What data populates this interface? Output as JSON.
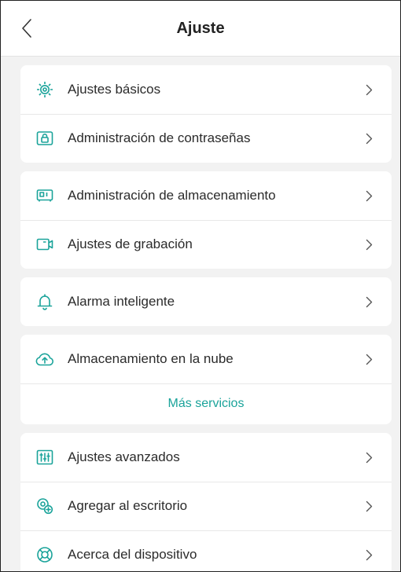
{
  "header": {
    "title": "Ajuste",
    "back_icon": "chevron-left-icon"
  },
  "colors": {
    "accent": "#1aa39a",
    "background": "#f2f2f2",
    "card": "#ffffff",
    "text": "#2b2b2b"
  },
  "groups": [
    {
      "items": [
        {
          "label": "Ajustes básicos",
          "icon": "gear-icon"
        },
        {
          "label": "Administración de contraseñas",
          "icon": "lock-icon"
        }
      ]
    },
    {
      "items": [
        {
          "label": "Administración de almacenamiento",
          "icon": "storage-icon"
        },
        {
          "label": "Ajustes de grabación",
          "icon": "video-camera-icon"
        }
      ]
    },
    {
      "items": [
        {
          "label": "Alarma inteligente",
          "icon": "bell-icon"
        }
      ]
    },
    {
      "items": [
        {
          "label": "Almacenamiento en la nube",
          "icon": "cloud-upload-icon"
        }
      ],
      "more_services": "Más servicios"
    },
    {
      "items": [
        {
          "label": "Ajustes avanzados",
          "icon": "sliders-icon"
        },
        {
          "label": "Agregar al escritorio",
          "icon": "add-desktop-icon"
        },
        {
          "label": "Acerca del dispositivo",
          "icon": "lifebuoy-icon"
        }
      ]
    }
  ]
}
